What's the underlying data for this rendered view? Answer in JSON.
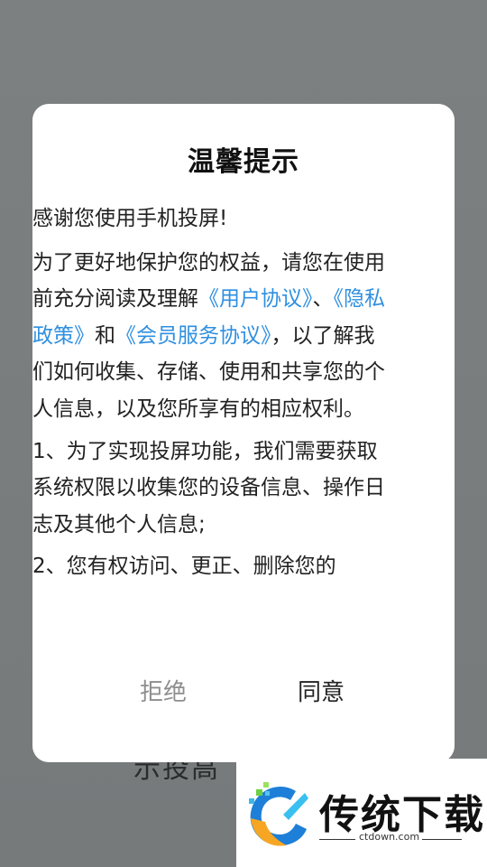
{
  "background": {
    "partial_text": "示投高"
  },
  "dialog": {
    "title": "温馨提示",
    "intro": "感谢您使用手机投屏!",
    "para2": {
      "before_links": "为了更好地保护您的权益，请您在使用前充分阅读及理解",
      "link_user_agreement": "《用户协议》",
      "sep1": "、",
      "link_privacy_policy": "《隐私政策》",
      "and": "和",
      "link_member_agreement": "《会员服务协议》",
      "after_links": "，以了解我们如何收集、存储、使用和共享您的个人信息，以及您所享有的相应权利。"
    },
    "item1": "1、为了实现投屏功能，我们需要获取系统权限以收集您的设备信息、操作日志及其他个人信息;",
    "item2": "2、您有权访问、更正、删除您的",
    "buttons": {
      "reject": "拒绝",
      "agree": "同意"
    }
  },
  "watermark": {
    "name": "传统下载",
    "url": "ctdown.com"
  },
  "colors": {
    "link": "#2f8fe0",
    "overlay": "#797d7e",
    "reject_text": "#8e8e8e"
  }
}
